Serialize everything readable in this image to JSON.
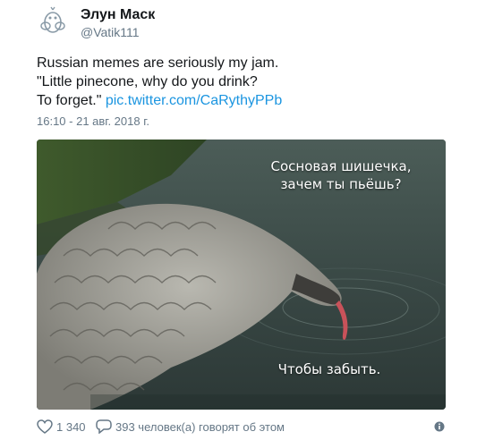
{
  "tweet": {
    "author_name": "Элун Маск",
    "author_handle": "@Vatik111",
    "text_lines": [
      "Russian memes are seriously my jam.",
      "\"Little pinecone, why do you drink?",
      "To forget.\""
    ],
    "link_text": "pic.twitter.com/CaRythyPPb",
    "timestamp": "16:10 - 21 авг. 2018 г.",
    "media": {
      "caption_top_line1": "Сосновая шишечка,",
      "caption_top_line2": "зачем ты пьёшь?",
      "caption_bottom": "Чтобы забыть."
    },
    "likes_count": "1 340",
    "replies_text": "393 человек(а) говорят об этом",
    "colors": {
      "link": "#1b95e0",
      "muted": "#657786",
      "text": "#14171a"
    },
    "icons": {
      "avatar": "egg-avatar-icon",
      "like": "heart-icon",
      "reply": "speech-bubble-icon",
      "info": "info-icon"
    }
  }
}
